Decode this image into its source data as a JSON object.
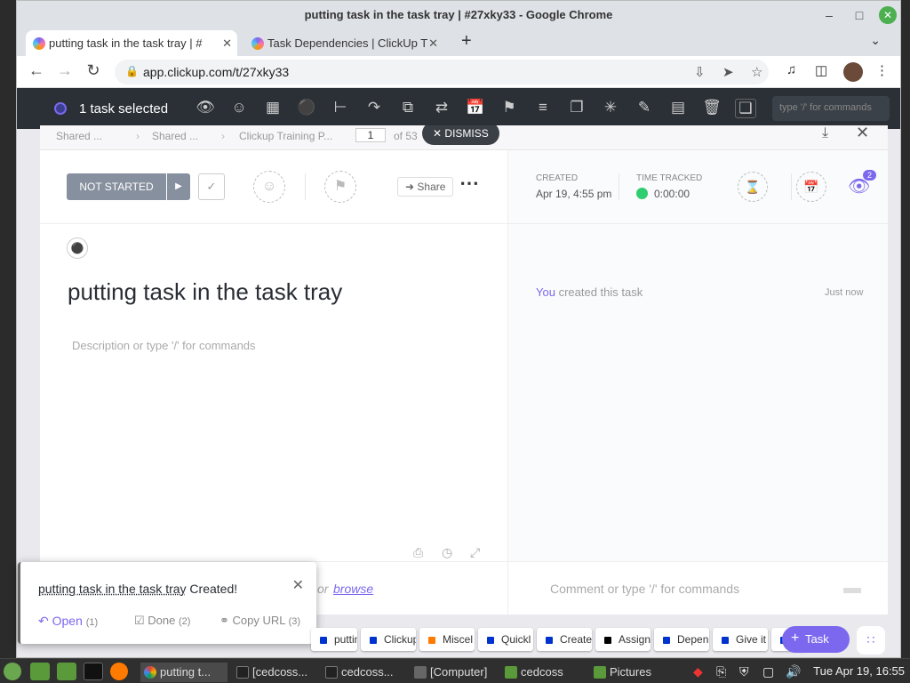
{
  "window": {
    "title": "putting task in the task tray | #27xky33 - Google Chrome"
  },
  "tabs": [
    {
      "label": "putting task in the task tray | #",
      "active": true
    },
    {
      "label": "Task Dependencies | ClickUp T",
      "active": false
    }
  ],
  "address": {
    "url": "app.clickup.com/t/27xky33"
  },
  "bulkbar": {
    "selected_text": "1 task selected",
    "command_placeholder": "type '/' for commands"
  },
  "breadcrumb": {
    "items": [
      "Shared ...",
      "Shared ...",
      "Clickup Training P..."
    ],
    "page_value": "1",
    "page_of": "of 53",
    "dismiss_label": "DISMISS"
  },
  "task": {
    "status": "NOT STARTED",
    "share_label": "Share",
    "title": "putting task in the task tray",
    "description_placeholder": "Description or type '/' for commands"
  },
  "meta": {
    "created_label": "CREATED",
    "created_value": "Apr 19, 4:55 pm",
    "time_label": "TIME TRACKED",
    "time_value": "0:00:00",
    "watchers": "2"
  },
  "activity": {
    "actor": "You",
    "text": "created this task",
    "time": "Just now"
  },
  "bottom": {
    "browse_prefix": "or",
    "browse": "browse",
    "comment_placeholder": "Comment or type '/' for commands"
  },
  "toast": {
    "task_name": "putting task in the task tray",
    "suffix": "Created!",
    "open_label": "Open",
    "open_key": "(1)",
    "done_label": "Done",
    "done_key": "(2)",
    "copy_label": "Copy URL",
    "copy_key": "(3)"
  },
  "tray": [
    {
      "label": "putting",
      "color": "#0033cc"
    },
    {
      "label": "Clickup",
      "color": "#0033cc"
    },
    {
      "label": "Miscel",
      "color": "#ff7a00"
    },
    {
      "label": "Quickl",
      "color": "#0033cc"
    },
    {
      "label": "Create",
      "color": "#0033cc"
    },
    {
      "label": "Assign",
      "color": "#000000"
    },
    {
      "label": "Depen",
      "color": "#0033cc"
    },
    {
      "label": "Give it",
      "color": "#0033cc"
    },
    {
      "label": "P",
      "color": "#0033cc"
    }
  ],
  "task_fab_label": "Task",
  "taskbar": {
    "items": [
      "putting t...",
      "[cedcoss...",
      "cedcoss...",
      "[Computer]",
      "cedcoss",
      "Pictures"
    ],
    "clock": "Tue Apr 19, 16:55"
  },
  "colors": {
    "accent": "#7b68ee",
    "status_gray": "#87909e",
    "timer_green": "#2ecd6f"
  }
}
